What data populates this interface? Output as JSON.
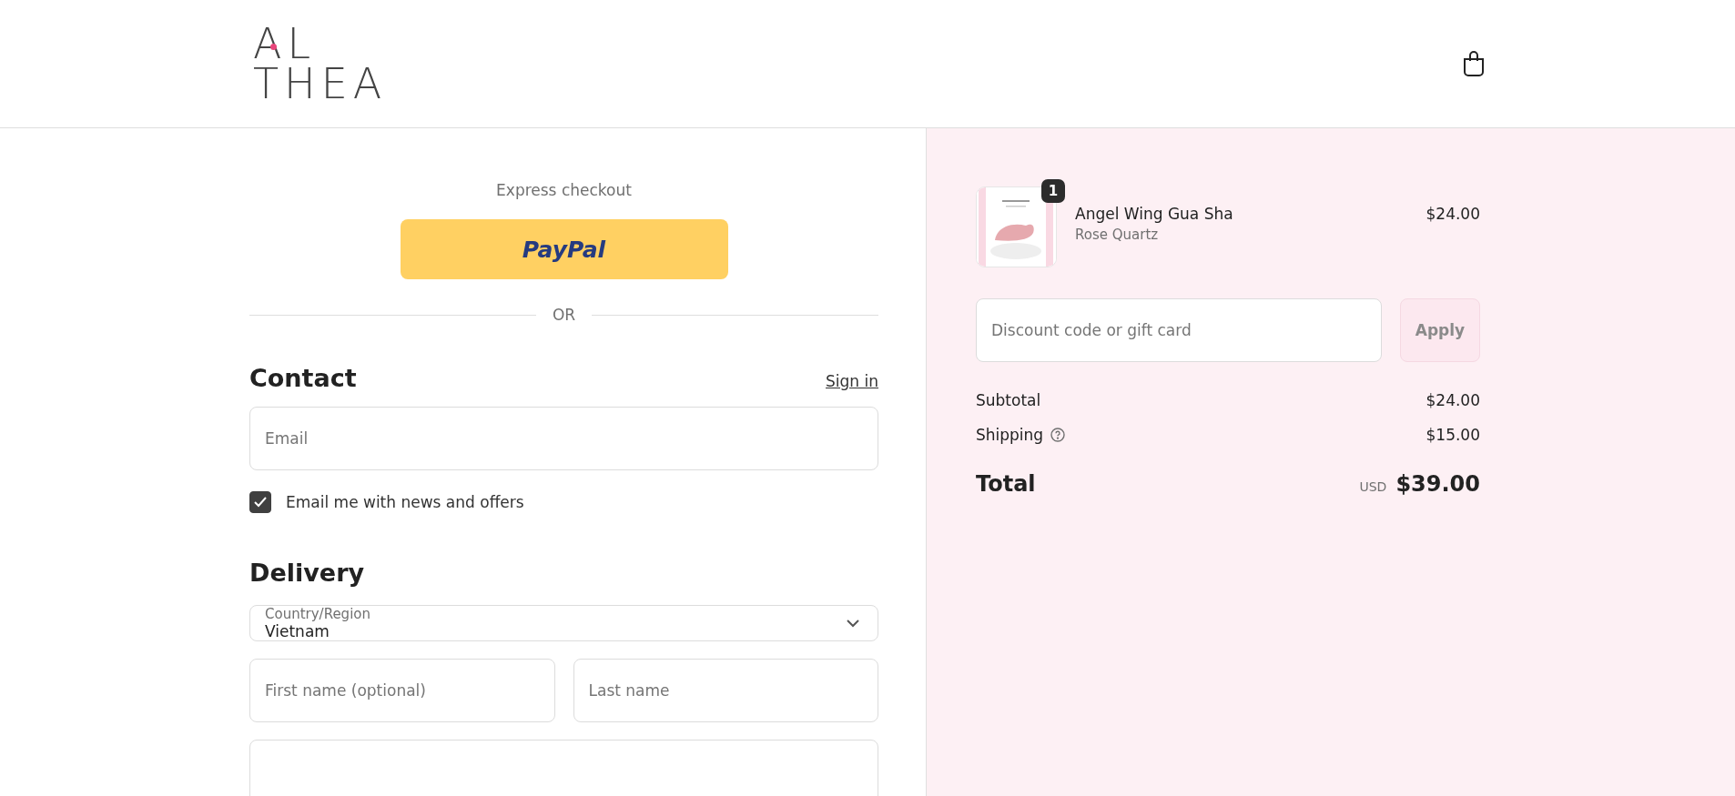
{
  "header": {
    "logo": [
      "AL",
      "THEA"
    ]
  },
  "express": {
    "title": "Express checkout",
    "button": "PayPal",
    "divider": "OR"
  },
  "contact": {
    "heading": "Contact",
    "sign_in": "Sign in",
    "email": {
      "placeholder": "Email"
    },
    "newsletter": {
      "label": "Email me with news and offers",
      "checked": true
    }
  },
  "delivery": {
    "heading": "Delivery",
    "country": {
      "label": "Country/Region",
      "value": "Vietnam"
    },
    "first_name": {
      "placeholder": "First name (optional)"
    },
    "last_name": {
      "placeholder": "Last name"
    },
    "address": {
      "kind": "input"
    }
  },
  "summary": {
    "items": [
      {
        "name": "Angel Wing Gua Sha",
        "variant": "Rose Quartz",
        "price": "$24.00",
        "quantity": "1"
      }
    ],
    "discount": {
      "placeholder": "Discount code or gift card",
      "button": "Apply"
    },
    "lines": [
      {
        "label": "Subtotal",
        "value": "$24.00",
        "info": false
      },
      {
        "label": "Shipping",
        "value": "$15.00",
        "info": true
      }
    ],
    "total": {
      "label": "Total",
      "currency": "USD",
      "value": "$39.00"
    }
  }
}
